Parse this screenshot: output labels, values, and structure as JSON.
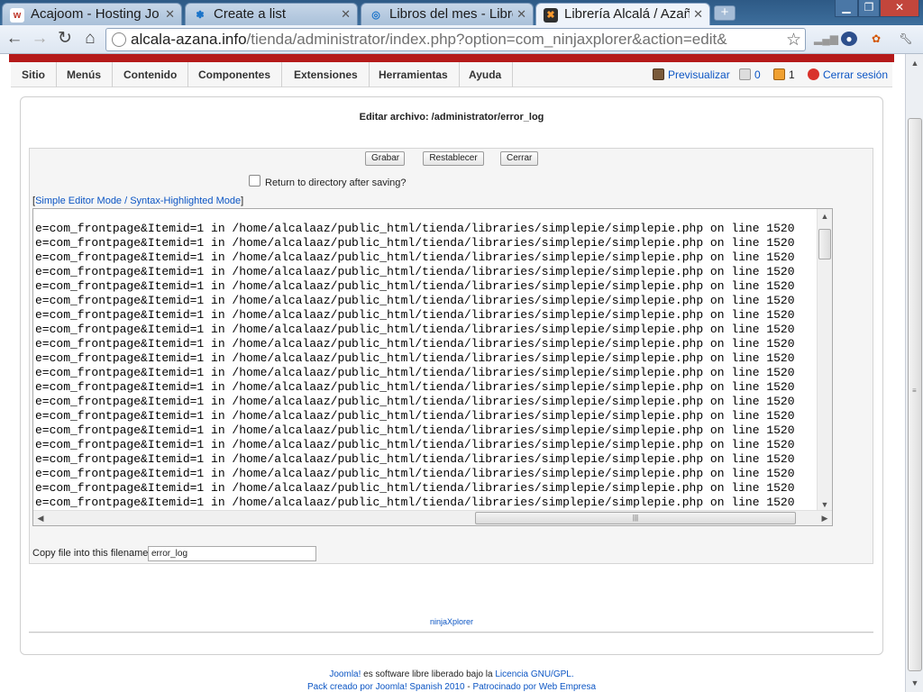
{
  "browser": {
    "tabs": [
      {
        "favicon": "w",
        "title": "Acajoom - Hosting Jo",
        "active": false
      },
      {
        "favicon": "✽",
        "title": "Create a list",
        "active": false
      },
      {
        "favicon": "◎",
        "title": "Libros del mes - Libre",
        "active": false
      },
      {
        "favicon": "✖",
        "title": "Librería Alcalá / Azañ",
        "active": true
      }
    ],
    "url_host": "alcala-azana.info",
    "url_path": "/tienda/administrator/index.php?option=com_ninjaxplorer&action=edit&"
  },
  "menu": {
    "items": [
      "Sitio",
      "Menús",
      "Contenido",
      "Componentes",
      "Extensiones",
      "Herramientas",
      "Ayuda"
    ],
    "preview_label": "Previsualizar",
    "messages_count": "0",
    "users_count": "1",
    "logout_label": "Cerrar sesión"
  },
  "editor": {
    "title": "Editar archivo: /administrator/error_log",
    "save_label": "Grabar",
    "reset_label": "Restablecer",
    "close_label": "Cerrar",
    "return_label": "Return to directory after saving?",
    "mode_link": "Simple Editor Mode / Syntax-Highlighted Mode",
    "code_line": "e=com_frontpage&Itemid=1 in /home/alcalaaz/public_html/tienda/libraries/simplepie/simplepie.php on line 1520",
    "visible_line_count": 20,
    "copy_label": "Copy file into this filename",
    "copy_value": "error_log"
  },
  "ninja_link": "ninjaXplorer",
  "footer": {
    "joomla_link": "Joomla!",
    "text1": "es software libre liberado bajo la",
    "license_link": "Licencia GNU/GPL.",
    "pack_text": "Pack creado por Joomla! Spanish 2010",
    "sep": "-",
    "sponsor_text": "Patrocinado por Web Empresa"
  },
  "colors": {
    "accent_red": "#b51a1a",
    "link_blue": "#0b55c4"
  }
}
